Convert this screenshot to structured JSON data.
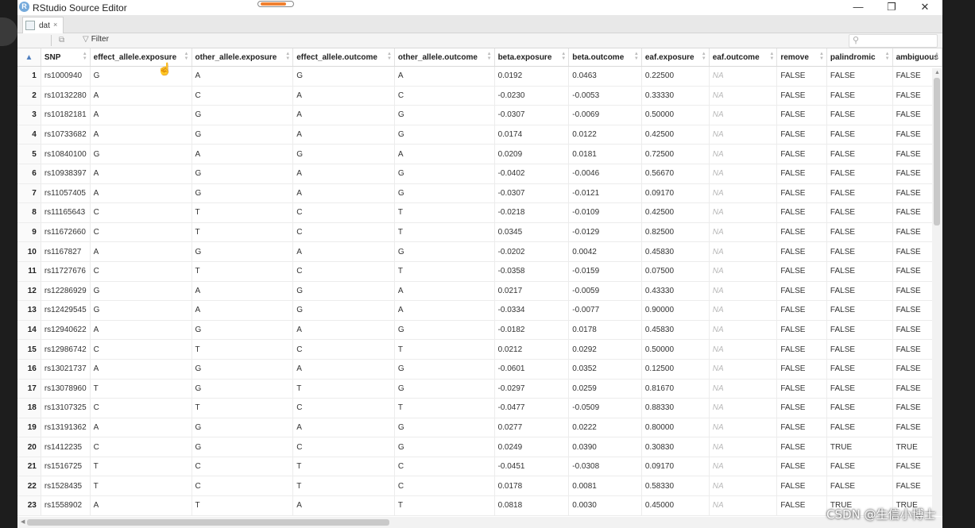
{
  "window": {
    "title": "RStudio Source Editor",
    "app_icon": "R"
  },
  "controls": {
    "minimize": "—",
    "restore": "❐",
    "close": "✕"
  },
  "tab": {
    "label": "dat",
    "close": "×"
  },
  "toolbar": {
    "filter_label": "Filter"
  },
  "table": {
    "columns": [
      "SNP",
      "effect_allele.exposure",
      "other_allele.exposure",
      "effect_allele.outcome",
      "other_allele.outcome",
      "beta.exposure",
      "beta.outcome",
      "eaf.exposure",
      "eaf.outcome",
      "remove",
      "palindromic",
      "ambiguous"
    ],
    "rows": [
      [
        "1",
        "rs1000940",
        "G",
        "A",
        "G",
        "A",
        "0.0192",
        "0.0463",
        "0.22500",
        "NA",
        "FALSE",
        "FALSE",
        "FALSE"
      ],
      [
        "2",
        "rs10132280",
        "A",
        "C",
        "A",
        "C",
        "-0.0230",
        "-0.0053",
        "0.33330",
        "NA",
        "FALSE",
        "FALSE",
        "FALSE"
      ],
      [
        "3",
        "rs10182181",
        "A",
        "G",
        "A",
        "G",
        "-0.0307",
        "-0.0069",
        "0.50000",
        "NA",
        "FALSE",
        "FALSE",
        "FALSE"
      ],
      [
        "4",
        "rs10733682",
        "A",
        "G",
        "A",
        "G",
        "0.0174",
        "0.0122",
        "0.42500",
        "NA",
        "FALSE",
        "FALSE",
        "FALSE"
      ],
      [
        "5",
        "rs10840100",
        "G",
        "A",
        "G",
        "A",
        "0.0209",
        "0.0181",
        "0.72500",
        "NA",
        "FALSE",
        "FALSE",
        "FALSE"
      ],
      [
        "6",
        "rs10938397",
        "A",
        "G",
        "A",
        "G",
        "-0.0402",
        "-0.0046",
        "0.56670",
        "NA",
        "FALSE",
        "FALSE",
        "FALSE"
      ],
      [
        "7",
        "rs11057405",
        "A",
        "G",
        "A",
        "G",
        "-0.0307",
        "-0.0121",
        "0.09170",
        "NA",
        "FALSE",
        "FALSE",
        "FALSE"
      ],
      [
        "8",
        "rs11165643",
        "C",
        "T",
        "C",
        "T",
        "-0.0218",
        "-0.0109",
        "0.42500",
        "NA",
        "FALSE",
        "FALSE",
        "FALSE"
      ],
      [
        "9",
        "rs11672660",
        "C",
        "T",
        "C",
        "T",
        "0.0345",
        "-0.0129",
        "0.82500",
        "NA",
        "FALSE",
        "FALSE",
        "FALSE"
      ],
      [
        "10",
        "rs1167827",
        "A",
        "G",
        "A",
        "G",
        "-0.0202",
        "0.0042",
        "0.45830",
        "NA",
        "FALSE",
        "FALSE",
        "FALSE"
      ],
      [
        "11",
        "rs11727676",
        "C",
        "T",
        "C",
        "T",
        "-0.0358",
        "-0.0159",
        "0.07500",
        "NA",
        "FALSE",
        "FALSE",
        "FALSE"
      ],
      [
        "12",
        "rs12286929",
        "G",
        "A",
        "G",
        "A",
        "0.0217",
        "-0.0059",
        "0.43330",
        "NA",
        "FALSE",
        "FALSE",
        "FALSE"
      ],
      [
        "13",
        "rs12429545",
        "G",
        "A",
        "G",
        "A",
        "-0.0334",
        "-0.0077",
        "0.90000",
        "NA",
        "FALSE",
        "FALSE",
        "FALSE"
      ],
      [
        "14",
        "rs12940622",
        "A",
        "G",
        "A",
        "G",
        "-0.0182",
        "0.0178",
        "0.45830",
        "NA",
        "FALSE",
        "FALSE",
        "FALSE"
      ],
      [
        "15",
        "rs12986742",
        "C",
        "T",
        "C",
        "T",
        "0.0212",
        "0.0292",
        "0.50000",
        "NA",
        "FALSE",
        "FALSE",
        "FALSE"
      ],
      [
        "16",
        "rs13021737",
        "A",
        "G",
        "A",
        "G",
        "-0.0601",
        "0.0352",
        "0.12500",
        "NA",
        "FALSE",
        "FALSE",
        "FALSE"
      ],
      [
        "17",
        "rs13078960",
        "T",
        "G",
        "T",
        "G",
        "-0.0297",
        "0.0259",
        "0.81670",
        "NA",
        "FALSE",
        "FALSE",
        "FALSE"
      ],
      [
        "18",
        "rs13107325",
        "C",
        "T",
        "C",
        "T",
        "-0.0477",
        "-0.0509",
        "0.88330",
        "NA",
        "FALSE",
        "FALSE",
        "FALSE"
      ],
      [
        "19",
        "rs13191362",
        "A",
        "G",
        "A",
        "G",
        "0.0277",
        "0.0222",
        "0.80000",
        "NA",
        "FALSE",
        "FALSE",
        "FALSE"
      ],
      [
        "20",
        "rs1412235",
        "C",
        "G",
        "C",
        "G",
        "0.0249",
        "0.0390",
        "0.30830",
        "NA",
        "FALSE",
        "TRUE",
        "TRUE"
      ],
      [
        "21",
        "rs1516725",
        "T",
        "C",
        "T",
        "C",
        "-0.0451",
        "-0.0308",
        "0.09170",
        "NA",
        "FALSE",
        "FALSE",
        "FALSE"
      ],
      [
        "22",
        "rs1528435",
        "T",
        "C",
        "T",
        "C",
        "0.0178",
        "0.0081",
        "0.58330",
        "NA",
        "FALSE",
        "FALSE",
        "FALSE"
      ],
      [
        "23",
        "rs1558902",
        "A",
        "T",
        "A",
        "T",
        "0.0818",
        "0.0030",
        "0.45000",
        "NA",
        "FALSE",
        "TRUE",
        "TRUE"
      ]
    ]
  },
  "watermark": "CSDN @生信小博士"
}
